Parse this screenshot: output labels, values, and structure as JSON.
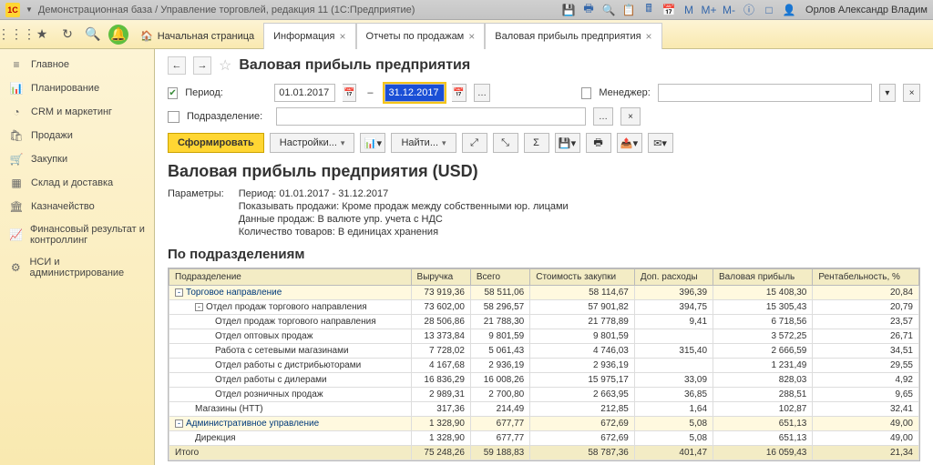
{
  "titlebar": {
    "logo_text": "1C",
    "title": "Демонстрационная база / Управление торговлей, редакция 11   (1С:Предприятие)",
    "user": "Орлов Александр Владим"
  },
  "tabs": {
    "home": "Начальная страница",
    "t1": "Информация",
    "t2": "Отчеты по продажам",
    "t3": "Валовая прибыль предприятия"
  },
  "sidebar": {
    "items": [
      {
        "icon": "≡",
        "label": "Главное"
      },
      {
        "icon": "📊",
        "label": "Планирование"
      },
      {
        "icon": "◔",
        "label": "CRM и маркетинг"
      },
      {
        "icon": "🛍",
        "label": "Продажи"
      },
      {
        "icon": "🛒",
        "label": "Закупки"
      },
      {
        "icon": "▦",
        "label": "Склад и доставка"
      },
      {
        "icon": "🏛",
        "label": "Казначейство"
      },
      {
        "icon": "📈",
        "label": "Финансовый результат и контроллинг"
      },
      {
        "icon": "⚙",
        "label": "НСИ и администрирование"
      }
    ]
  },
  "page": {
    "title": "Валовая прибыль предприятия",
    "period_label": "Период:",
    "date_from": "01.01.2017",
    "date_to": "31.12.2017",
    "dept_label": "Подразделение:",
    "mgr_label": "Менеджер:",
    "btn_form": "Сформировать",
    "btn_settings": "Настройки...",
    "btn_find": "Найти..."
  },
  "report": {
    "title": "Валовая прибыль предприятия (USD)",
    "param_label": "Параметры:",
    "params": [
      "Период: 01.01.2017 - 31.12.2017",
      "Показывать продажи: Кроме продаж между собственными юр. лицами",
      "Данные продаж: В валюте упр. учета с НДС",
      "Количество товаров: В единицах хранения"
    ],
    "section": "По подразделениям",
    "headers": [
      "Подразделение",
      "Выручка",
      "Всего",
      "Стоимость закупки",
      "Доп. расходы",
      "Валовая прибыль",
      "Рентабельность, %"
    ],
    "rows": [
      {
        "lvl": 0,
        "hl": true,
        "exp": "-",
        "name": "Торговое направление",
        "v": [
          "73 919,36",
          "58 511,06",
          "58 114,67",
          "396,39",
          "15 408,30",
          "20,84"
        ]
      },
      {
        "lvl": 1,
        "exp": "-",
        "name": "Отдел продаж торгового направления",
        "v": [
          "73 602,00",
          "58 296,57",
          "57 901,82",
          "394,75",
          "15 305,43",
          "20,79"
        ]
      },
      {
        "lvl": 2,
        "name": "Отдел продаж торгового направления",
        "v": [
          "28 506,86",
          "21 788,30",
          "21 778,89",
          "9,41",
          "6 718,56",
          "23,57"
        ]
      },
      {
        "lvl": 2,
        "name": "Отдел оптовых продаж",
        "v": [
          "13 373,84",
          "9 801,59",
          "9 801,59",
          "",
          "3 572,25",
          "26,71"
        ]
      },
      {
        "lvl": 2,
        "name": "Работа с сетевыми магазинами",
        "v": [
          "7 728,02",
          "5 061,43",
          "4 746,03",
          "315,40",
          "2 666,59",
          "34,51"
        ]
      },
      {
        "lvl": 2,
        "name": "Отдел работы с дистрибьюторами",
        "v": [
          "4 167,68",
          "2 936,19",
          "2 936,19",
          "",
          "1 231,49",
          "29,55"
        ]
      },
      {
        "lvl": 2,
        "name": "Отдел работы с дилерами",
        "v": [
          "16 836,29",
          "16 008,26",
          "15 975,17",
          "33,09",
          "828,03",
          "4,92"
        ]
      },
      {
        "lvl": 2,
        "name": "Отдел розничных продаж",
        "v": [
          "2 989,31",
          "2 700,80",
          "2 663,95",
          "36,85",
          "288,51",
          "9,65"
        ]
      },
      {
        "lvl": 1,
        "name": "Магазины (НТТ)",
        "v": [
          "317,36",
          "214,49",
          "212,85",
          "1,64",
          "102,87",
          "32,41"
        ]
      },
      {
        "lvl": 0,
        "hl": true,
        "exp": "-",
        "name": "Административное управление",
        "v": [
          "1 328,90",
          "677,77",
          "672,69",
          "5,08",
          "651,13",
          "49,00"
        ]
      },
      {
        "lvl": 1,
        "name": "Дирекция",
        "v": [
          "1 328,90",
          "677,77",
          "672,69",
          "5,08",
          "651,13",
          "49,00"
        ]
      }
    ],
    "total": {
      "name": "Итого",
      "v": [
        "75 248,26",
        "59 188,83",
        "58 787,36",
        "401,47",
        "16 059,43",
        "21,34"
      ]
    }
  },
  "chart_data": {
    "type": "table",
    "title": "Валовая прибыль предприятия (USD) — По подразделениям",
    "columns": [
      "Подразделение",
      "Выручка",
      "Всего",
      "Стоимость закупки",
      "Доп. расходы",
      "Валовая прибыль",
      "Рентабельность, %"
    ],
    "rows": [
      [
        "Торговое направление",
        73919.36,
        58511.06,
        58114.67,
        396.39,
        15408.3,
        20.84
      ],
      [
        "Отдел продаж торгового направления",
        73602.0,
        58296.57,
        57901.82,
        394.75,
        15305.43,
        20.79
      ],
      [
        "Отдел продаж торгового направления",
        28506.86,
        21788.3,
        21778.89,
        9.41,
        6718.56,
        23.57
      ],
      [
        "Отдел оптовых продаж",
        13373.84,
        9801.59,
        9801.59,
        null,
        3572.25,
        26.71
      ],
      [
        "Работа с сетевыми магазинами",
        7728.02,
        5061.43,
        4746.03,
        315.4,
        2666.59,
        34.51
      ],
      [
        "Отдел работы с дистрибьюторами",
        4167.68,
        2936.19,
        2936.19,
        null,
        1231.49,
        29.55
      ],
      [
        "Отдел работы с дилерами",
        16836.29,
        16008.26,
        15975.17,
        33.09,
        828.03,
        4.92
      ],
      [
        "Отдел розничных продаж",
        2989.31,
        2700.8,
        2663.95,
        36.85,
        288.51,
        9.65
      ],
      [
        "Магазины (НТТ)",
        317.36,
        214.49,
        212.85,
        1.64,
        102.87,
        32.41
      ],
      [
        "Административное управление",
        1328.9,
        677.77,
        672.69,
        5.08,
        651.13,
        49.0
      ],
      [
        "Дирекция",
        1328.9,
        677.77,
        672.69,
        5.08,
        651.13,
        49.0
      ],
      [
        "Итого",
        75248.26,
        59188.83,
        58787.36,
        401.47,
        16059.43,
        21.34
      ]
    ]
  }
}
